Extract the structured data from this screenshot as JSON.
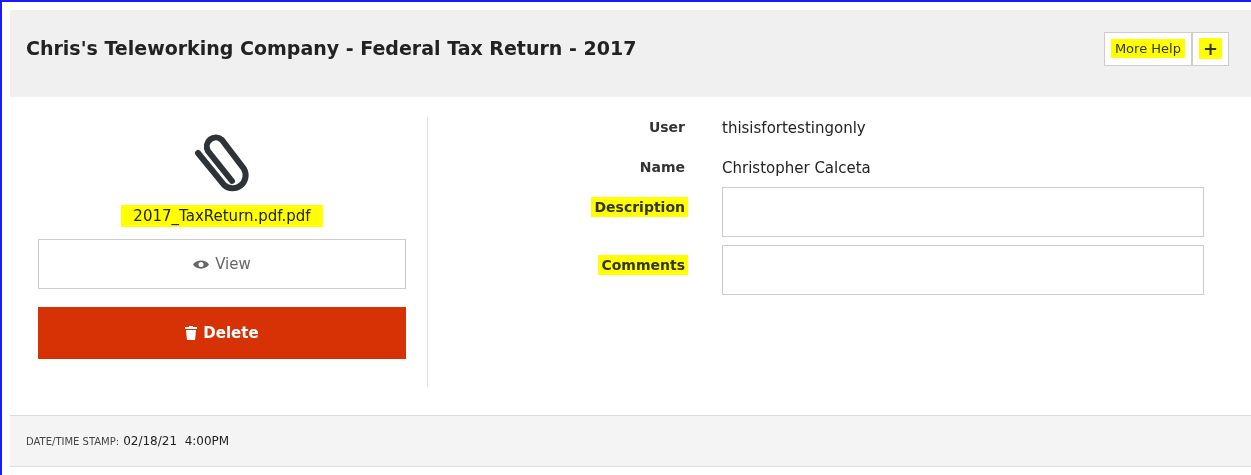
{
  "header": {
    "title": "Chris's Teleworking Company - Federal Tax Return - 2017",
    "buttons": [
      {
        "kind": "text",
        "label": "More Help",
        "highlighted": true
      },
      {
        "kind": "plus",
        "label": "+",
        "highlighted": true
      }
    ]
  },
  "attachment": {
    "filename": "2017_TaxReturn.pdf.pdf",
    "highlighted": true,
    "view_label": "View",
    "delete_label": "Delete"
  },
  "details": [
    {
      "kind": "text",
      "label": "User",
      "value": "thisisfortestingonly",
      "highlighted": false
    },
    {
      "kind": "text",
      "label": "Name",
      "value": "Christopher  Calceta",
      "highlighted": false
    },
    {
      "kind": "field",
      "label": "Description",
      "highlighted": true
    },
    {
      "kind": "field",
      "label": "Comments",
      "highlighted": true
    }
  ],
  "footer": {
    "label": "DATE/TIME STAMP:",
    "value": "02/18/21  4:00PM"
  }
}
